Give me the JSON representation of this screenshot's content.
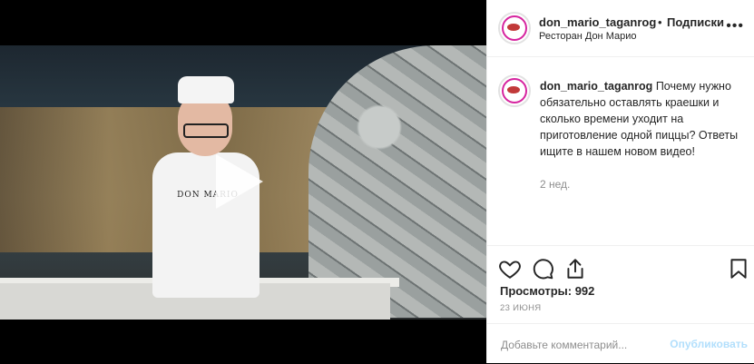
{
  "header": {
    "username": "don_mario_taganrog",
    "separator": "•",
    "follow_label": "Подписки",
    "location": "Ресторан Дон Марио"
  },
  "video": {
    "apron_text": "DON MARIO"
  },
  "caption": {
    "username": "don_mario_taganrog",
    "text": "Почему нужно обязательно оставлять краешки и сколько времени уходит на приготовление одной пиццы? Ответы ищите в нашем новом видео!",
    "age": "2 нед."
  },
  "stats": {
    "views_label": "Просмотры: 992",
    "date": "23 ИЮНЯ"
  },
  "comment": {
    "placeholder": "Добавьте комментарий...",
    "publish_label": "Опубликовать"
  },
  "colors": {
    "accent_light": "#b2dffc",
    "text_primary": "#262626",
    "text_secondary": "#8e8e8e"
  },
  "icons": [
    "more-icon",
    "heart-icon",
    "comment-icon",
    "share-icon",
    "bookmark-icon",
    "play-icon"
  ]
}
